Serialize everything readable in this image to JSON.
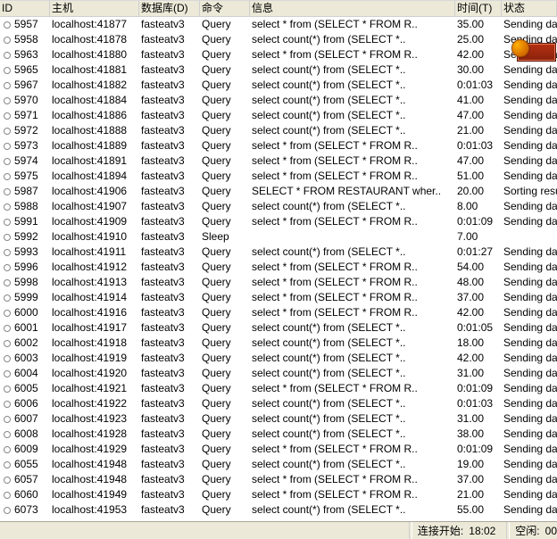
{
  "columns": {
    "id": "ID",
    "host": "主机",
    "db": "数据库(D)",
    "cmd": "命令",
    "info": "信息",
    "time": "时间(T)",
    "state": "状态"
  },
  "rows": [
    {
      "id": "5957",
      "host": "localhost:41877",
      "db": "fasteatv3",
      "cmd": "Query",
      "info": "select * from (SELECT * FROM R..",
      "time": "35.00",
      "state": "Sending data"
    },
    {
      "id": "5958",
      "host": "localhost:41878",
      "db": "fasteatv3",
      "cmd": "Query",
      "info": "select count(*) from (SELECT *..",
      "time": "25.00",
      "state": "Sending data"
    },
    {
      "id": "5963",
      "host": "localhost:41880",
      "db": "fasteatv3",
      "cmd": "Query",
      "info": "select * from (SELECT * FROM R..",
      "time": "42.00",
      "state": "Sending data"
    },
    {
      "id": "5965",
      "host": "localhost:41881",
      "db": "fasteatv3",
      "cmd": "Query",
      "info": "select count(*) from (SELECT *..",
      "time": "30.00",
      "state": "Sending data"
    },
    {
      "id": "5967",
      "host": "localhost:41882",
      "db": "fasteatv3",
      "cmd": "Query",
      "info": "select count(*) from (SELECT *..",
      "time": "0:01:03",
      "state": "Sending data"
    },
    {
      "id": "5970",
      "host": "localhost:41884",
      "db": "fasteatv3",
      "cmd": "Query",
      "info": "select count(*) from (SELECT *..",
      "time": "41.00",
      "state": "Sending data"
    },
    {
      "id": "5971",
      "host": "localhost:41886",
      "db": "fasteatv3",
      "cmd": "Query",
      "info": "select count(*) from (SELECT *..",
      "time": "47.00",
      "state": "Sending data"
    },
    {
      "id": "5972",
      "host": "localhost:41888",
      "db": "fasteatv3",
      "cmd": "Query",
      "info": "select count(*) from (SELECT *..",
      "time": "21.00",
      "state": "Sending data"
    },
    {
      "id": "5973",
      "host": "localhost:41889",
      "db": "fasteatv3",
      "cmd": "Query",
      "info": "select * from (SELECT * FROM R..",
      "time": "0:01:03",
      "state": "Sending data"
    },
    {
      "id": "5974",
      "host": "localhost:41891",
      "db": "fasteatv3",
      "cmd": "Query",
      "info": "select * from (SELECT * FROM R..",
      "time": "47.00",
      "state": "Sending data"
    },
    {
      "id": "5975",
      "host": "localhost:41894",
      "db": "fasteatv3",
      "cmd": "Query",
      "info": "select * from (SELECT * FROM R..",
      "time": "51.00",
      "state": "Sending data"
    },
    {
      "id": "5987",
      "host": "localhost:41906",
      "db": "fasteatv3",
      "cmd": "Query",
      "info": "SELECT * FROM RESTAURANT  wher..",
      "time": "20.00",
      "state": "Sorting result"
    },
    {
      "id": "5988",
      "host": "localhost:41907",
      "db": "fasteatv3",
      "cmd": "Query",
      "info": "select count(*) from (SELECT *..",
      "time": "8.00",
      "state": "Sending data"
    },
    {
      "id": "5991",
      "host": "localhost:41909",
      "db": "fasteatv3",
      "cmd": "Query",
      "info": "select * from (SELECT * FROM R..",
      "time": "0:01:09",
      "state": "Sending data"
    },
    {
      "id": "5992",
      "host": "localhost:41910",
      "db": "fasteatv3",
      "cmd": "Sleep",
      "info": "",
      "time": "7.00",
      "state": ""
    },
    {
      "id": "5993",
      "host": "localhost:41911",
      "db": "fasteatv3",
      "cmd": "Query",
      "info": "select count(*) from (SELECT *..",
      "time": "0:01:27",
      "state": "Sending data"
    },
    {
      "id": "5996",
      "host": "localhost:41912",
      "db": "fasteatv3",
      "cmd": "Query",
      "info": "select * from (SELECT * FROM R..",
      "time": "54.00",
      "state": "Sending data"
    },
    {
      "id": "5998",
      "host": "localhost:41913",
      "db": "fasteatv3",
      "cmd": "Query",
      "info": "select * from (SELECT * FROM R..",
      "time": "48.00",
      "state": "Sending data"
    },
    {
      "id": "5999",
      "host": "localhost:41914",
      "db": "fasteatv3",
      "cmd": "Query",
      "info": "select * from (SELECT * FROM R..",
      "time": "37.00",
      "state": "Sending data"
    },
    {
      "id": "6000",
      "host": "localhost:41916",
      "db": "fasteatv3",
      "cmd": "Query",
      "info": "select * from (SELECT * FROM R..",
      "time": "42.00",
      "state": "Sending data"
    },
    {
      "id": "6001",
      "host": "localhost:41917",
      "db": "fasteatv3",
      "cmd": "Query",
      "info": "select count(*) from (SELECT *..",
      "time": "0:01:05",
      "state": "Sending data"
    },
    {
      "id": "6002",
      "host": "localhost:41918",
      "db": "fasteatv3",
      "cmd": "Query",
      "info": "select count(*) from (SELECT *..",
      "time": "18.00",
      "state": "Sending data"
    },
    {
      "id": "6003",
      "host": "localhost:41919",
      "db": "fasteatv3",
      "cmd": "Query",
      "info": "select count(*) from (SELECT *..",
      "time": "42.00",
      "state": "Sending data"
    },
    {
      "id": "6004",
      "host": "localhost:41920",
      "db": "fasteatv3",
      "cmd": "Query",
      "info": "select count(*) from (SELECT *..",
      "time": "31.00",
      "state": "Sending data"
    },
    {
      "id": "6005",
      "host": "localhost:41921",
      "db": "fasteatv3",
      "cmd": "Query",
      "info": "select * from (SELECT * FROM R..",
      "time": "0:01:09",
      "state": "Sending data"
    },
    {
      "id": "6006",
      "host": "localhost:41922",
      "db": "fasteatv3",
      "cmd": "Query",
      "info": "select count(*) from (SELECT *..",
      "time": "0:01:03",
      "state": "Sending data"
    },
    {
      "id": "6007",
      "host": "localhost:41923",
      "db": "fasteatv3",
      "cmd": "Query",
      "info": "select count(*) from (SELECT *..",
      "time": "31.00",
      "state": "Sending data"
    },
    {
      "id": "6008",
      "host": "localhost:41928",
      "db": "fasteatv3",
      "cmd": "Query",
      "info": "select count(*) from (SELECT *..",
      "time": "38.00",
      "state": "Sending data"
    },
    {
      "id": "6009",
      "host": "localhost:41929",
      "db": "fasteatv3",
      "cmd": "Query",
      "info": "select * from (SELECT * FROM R..",
      "time": "0:01:09",
      "state": "Sending data"
    },
    {
      "id": "6055",
      "host": "localhost:41948",
      "db": "fasteatv3",
      "cmd": "Query",
      "info": "select count(*) from (SELECT *..",
      "time": "19.00",
      "state": "Sending data"
    },
    {
      "id": "6057",
      "host": "localhost:41948",
      "db": "fasteatv3",
      "cmd": "Query",
      "info": "select * from (SELECT * FROM R..",
      "time": "37.00",
      "state": "Sending data"
    },
    {
      "id": "6060",
      "host": "localhost:41949",
      "db": "fasteatv3",
      "cmd": "Query",
      "info": "select * from (SELECT * FROM R..",
      "time": "21.00",
      "state": "Sending data"
    },
    {
      "id": "6073",
      "host": "localhost:41953",
      "db": "fasteatv3",
      "cmd": "Query",
      "info": "select count(*) from (SELECT *..",
      "time": "55.00",
      "state": "Sending data"
    }
  ],
  "status": {
    "connect_label": "连接开始:",
    "connect_value": "18:02",
    "idle_label": "空闲:",
    "idle_value": "00"
  }
}
